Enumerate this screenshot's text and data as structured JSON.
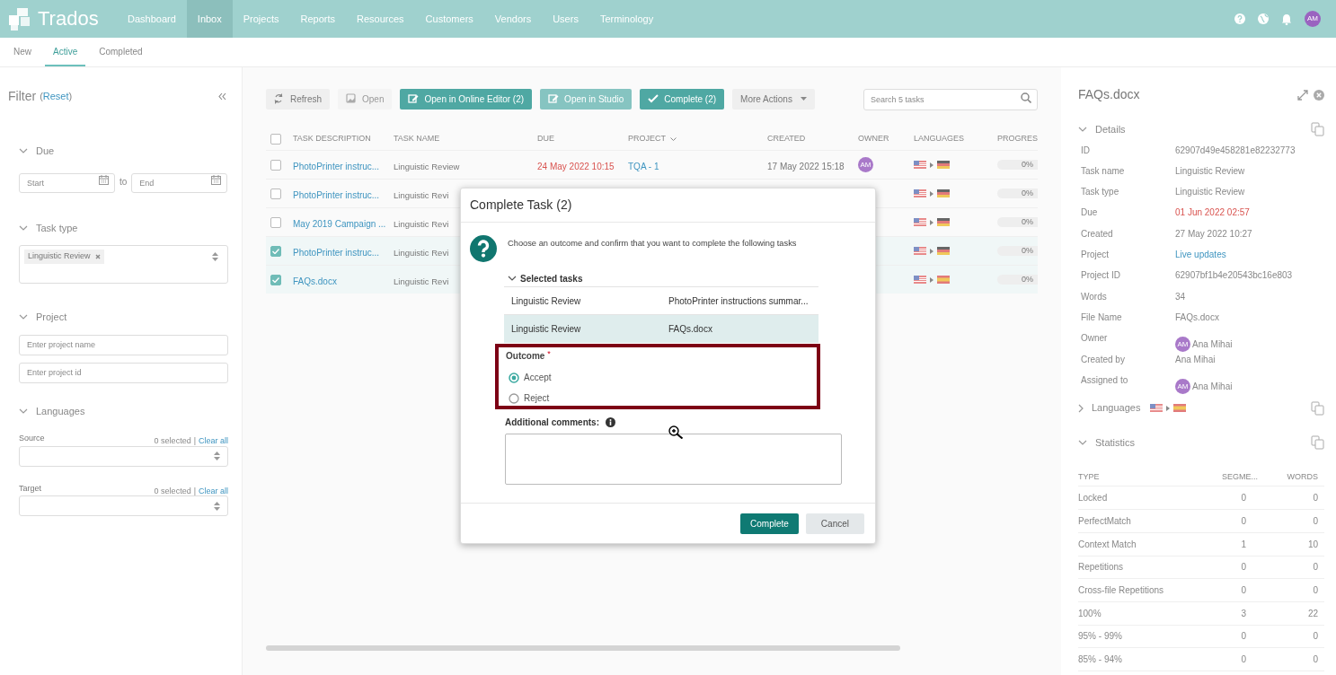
{
  "nav": {
    "logo": "Trados",
    "items": [
      {
        "label": "Dashboard",
        "selected": false
      },
      {
        "label": "Inbox",
        "selected": true
      },
      {
        "label": "Projects",
        "selected": false
      },
      {
        "label": "Reports",
        "selected": false
      },
      {
        "label": "Resources",
        "selected": false
      },
      {
        "label": "Customers",
        "selected": false
      },
      {
        "label": "Vendors",
        "selected": false
      },
      {
        "label": "Users",
        "selected": false
      },
      {
        "label": "Terminology",
        "selected": false
      }
    ],
    "avatar": "AM"
  },
  "subtabs": [
    {
      "label": "New",
      "selected": false
    },
    {
      "label": "Active",
      "selected": true
    },
    {
      "label": "Completed",
      "selected": false
    }
  ],
  "filter": {
    "title": "Filter",
    "paren_open": "(",
    "reset": "Reset",
    "paren_close": ")",
    "due": {
      "label": "Due",
      "expanded": true,
      "start_placeholder": "Start",
      "to": "to",
      "end_placeholder": "End"
    },
    "task_type": {
      "label": "Task type",
      "expanded": true,
      "tag": "Linguistic Review"
    },
    "project": {
      "label": "Project",
      "expanded": true,
      "name_placeholder": "Enter project name",
      "id_placeholder": "Enter project id"
    },
    "languages": {
      "label": "Languages",
      "expanded": true,
      "source": {
        "label": "Source",
        "count": "0 selected",
        "separator": "|",
        "clear": "Clear all"
      },
      "target": {
        "label": "Target",
        "count": "0 selected",
        "separator": "|",
        "clear": "Clear all"
      }
    }
  },
  "toolbar": {
    "buttons": [
      {
        "label": "Refresh",
        "kind": "plain"
      },
      {
        "label": "Open",
        "kind": "disabled"
      },
      {
        "label": "Open in Online Editor (2)",
        "kind": "primary"
      },
      {
        "label": "Open in Studio",
        "kind": "muted"
      },
      {
        "label": "Complete (2)",
        "kind": "primary"
      },
      {
        "label": "More Actions",
        "kind": "plain"
      }
    ],
    "search_placeholder": "Search 5 tasks"
  },
  "table": {
    "all_checked": false,
    "columns": [
      "TASK DESCRIPTION",
      "TASK NAME",
      "DUE",
      "PROJECT",
      "CREATED",
      "OWNER",
      "LANGUAGES",
      "PROGRES"
    ],
    "rows": [
      {
        "checked": false,
        "kind": "german",
        "description": "PhotoPrinter instruc...",
        "task_name": "Linguistic Review",
        "due": "24 May 2022 10:15",
        "project": "TQA - 1",
        "created": "17 May 2022 15:18",
        "owner": "AM",
        "level": 0,
        "progress": "0%"
      },
      {
        "checked": false,
        "kind": "german",
        "description": "PhotoPrinter instruc...",
        "task_name": "Linguistic Revi",
        "level": 0,
        "progress": "0%"
      },
      {
        "checked": false,
        "kind": "german",
        "description": "May 2019 Campaign ...",
        "task_name": "Linguistic Revi",
        "level": 0,
        "progress": "0%"
      },
      {
        "checked": true,
        "kind": "german",
        "description": "PhotoPrinter instruc...",
        "task_name": "Linguistic Revi",
        "level": 0,
        "progress": "0%"
      },
      {
        "checked": true,
        "kind": "spanish",
        "description": "FAQs.docx",
        "task_name": "Linguistic Revi",
        "level": 0,
        "progress": "0%"
      }
    ]
  },
  "details": {
    "title": "FAQs.docx",
    "sections": [
      {
        "label": "Details",
        "expanded": true,
        "kind": "plain"
      },
      {
        "label": "Languages",
        "expanded": false,
        "kind": "spanish"
      },
      {
        "label": "Statistics",
        "expanded": true,
        "kind": "plain"
      }
    ],
    "fields": [
      {
        "key": "ID",
        "value": "62907d49e458281e82232773",
        "kind": "text"
      },
      {
        "key": "Task name",
        "value": "Linguistic Review",
        "kind": "text"
      },
      {
        "key": "Task type",
        "value": "Linguistic Review",
        "kind": "text"
      },
      {
        "key": "Due",
        "value": "01 Jun 2022 02:57",
        "kind": "due"
      },
      {
        "key": "Created",
        "value": "27 May 2022 10:27",
        "kind": "text"
      },
      {
        "key": "Project",
        "value": "Live updates",
        "kind": "link"
      },
      {
        "key": "Project ID",
        "value": "62907bf1b4e20543bc16e803",
        "kind": "text"
      },
      {
        "key": "Words",
        "value": "34",
        "kind": "text"
      },
      {
        "key": "File Name",
        "value": "FAQs.docx",
        "kind": "text"
      },
      {
        "key": "Owner",
        "value": "Ana Mihai",
        "avatar": "AM",
        "kind": "user"
      },
      {
        "key": "Created by",
        "value": "Ana Mihai",
        "kind": "text"
      },
      {
        "key": "Assigned to",
        "value": "Ana Mihai",
        "avatar": "AM",
        "kind": "user"
      }
    ],
    "stats_columns": [
      "TYPE",
      "SEGME...",
      "WORDS"
    ],
    "stats": [
      [
        "Locked",
        "0",
        "0"
      ],
      [
        "PerfectMatch",
        "0",
        "0"
      ],
      [
        "Context Match",
        "1",
        "10"
      ],
      [
        "Repetitions",
        "0",
        "0"
      ],
      [
        "Cross-file Repetitions",
        "0",
        "0"
      ],
      [
        "100%",
        "3",
        "22"
      ],
      [
        "95% - 99%",
        "0",
        "0"
      ],
      [
        "85% - 94%",
        "0",
        "0"
      ]
    ]
  },
  "modal": {
    "title": "Complete Task (2)",
    "message": "Choose an outcome and confirm that you want to complete the following tasks",
    "selected_label": "Selected tasks",
    "selected_expanded": true,
    "tasks": [
      {
        "name": "Linguistic Review",
        "file": "PhotoPrinter instructions summar...",
        "selected": false
      },
      {
        "name": "Linguistic Review",
        "file": "FAQs.docx",
        "selected": true
      }
    ],
    "outcome_label": "Outcome",
    "required": "*",
    "options": [
      {
        "label": "Accept",
        "selected": true
      },
      {
        "label": "Reject",
        "selected": false
      }
    ],
    "comments_label": "Additional comments:",
    "confirm": "Complete",
    "cancel": "Cancel"
  }
}
